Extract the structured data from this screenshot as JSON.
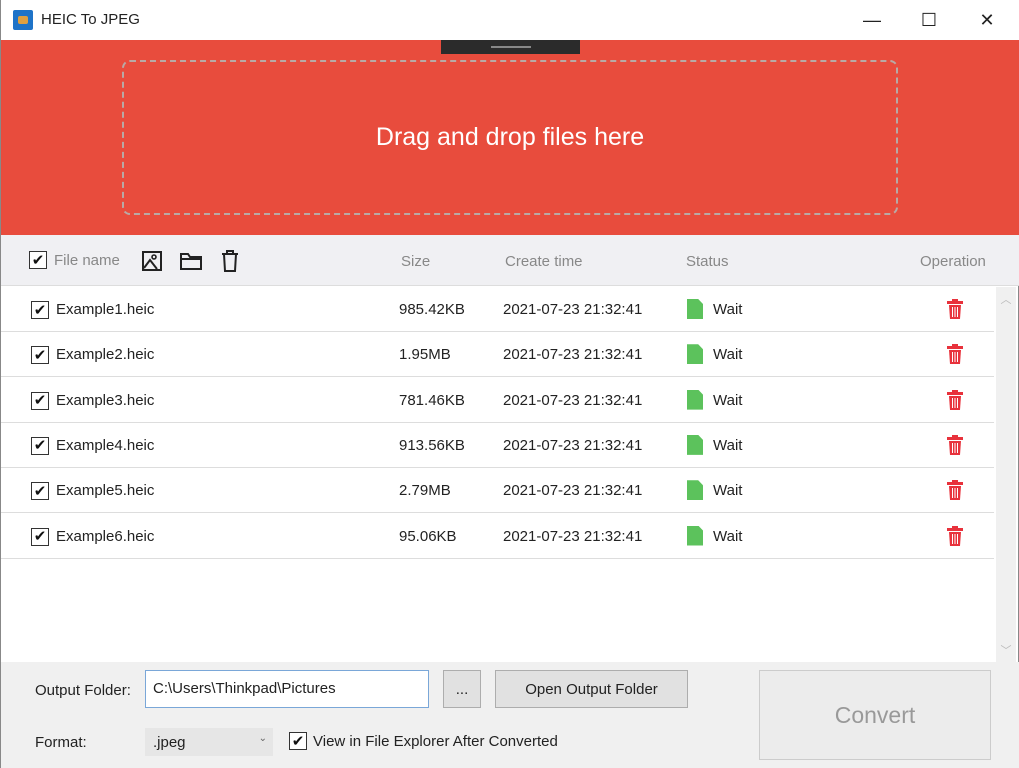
{
  "window": {
    "title": "HEIC To JPEG",
    "minimize": "—",
    "maximize": "☐",
    "close": "✕"
  },
  "dropzone": {
    "text": "Drag and drop files here"
  },
  "header": {
    "file_name": "File name",
    "size": "Size",
    "create_time": "Create time",
    "status": "Status",
    "operation": "Operation"
  },
  "files": [
    {
      "name": "Example1.heic",
      "size": "985.42KB",
      "time": "2021-07-23 21:32:41",
      "status": "Wait"
    },
    {
      "name": "Example2.heic",
      "size": "1.95MB",
      "time": "2021-07-23 21:32:41",
      "status": "Wait"
    },
    {
      "name": "Example3.heic",
      "size": "781.46KB",
      "time": "2021-07-23 21:32:41",
      "status": "Wait"
    },
    {
      "name": "Example4.heic",
      "size": "913.56KB",
      "time": "2021-07-23 21:32:41",
      "status": "Wait"
    },
    {
      "name": "Example5.heic",
      "size": "2.79MB",
      "time": "2021-07-23 21:32:41",
      "status": "Wait"
    },
    {
      "name": "Example6.heic",
      "size": "95.06KB",
      "time": "2021-07-23 21:32:41",
      "status": "Wait"
    }
  ],
  "bottom": {
    "output_label": "Output Folder:",
    "output_value": "C:\\Users\\Thinkpad\\Pictures",
    "browse": "...",
    "open_folder": "Open Output Folder",
    "convert": "Convert",
    "format_label": "Format:",
    "format_value": ".jpeg",
    "view_after": "View in File Explorer After Converted"
  },
  "colors": {
    "accent": "#e84c3d",
    "status_icon": "#5cc25c",
    "delete": "#e8323c"
  }
}
